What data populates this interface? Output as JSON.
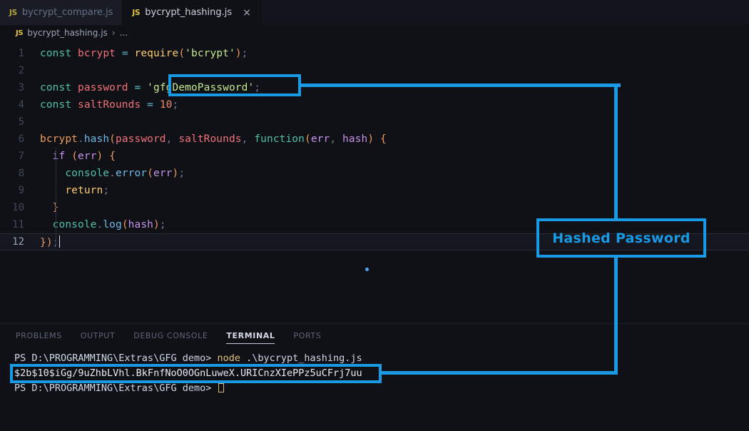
{
  "window": {
    "app": "Visual Studio Code",
    "theme_bg": "#0f1117",
    "accent": "#1a9ae4"
  },
  "tabs": [
    {
      "label": "bycrypt_compare.js",
      "icon": "js-file-icon",
      "badge": "JS",
      "active": false,
      "closable": false
    },
    {
      "label": "bycrypt_hashing.js",
      "icon": "js-file-icon",
      "badge": "JS",
      "active": true,
      "closable": true,
      "close_glyph": "×"
    }
  ],
  "breadcrumb": {
    "badge": "JS",
    "file": "bycrypt_hashing.js",
    "separator": "›",
    "more": "..."
  },
  "editor": {
    "language": "javascript",
    "active_line": 12,
    "lines": [
      {
        "n": "1",
        "tokens": [
          {
            "t": "const",
            "c": "t-kw"
          },
          {
            "t": " ",
            "c": ""
          },
          {
            "t": "bcrypt",
            "c": "t-var"
          },
          {
            "t": " ",
            "c": ""
          },
          {
            "t": "=",
            "c": "t-op"
          },
          {
            "t": " ",
            "c": ""
          },
          {
            "t": "require",
            "c": "t-fn"
          },
          {
            "t": "(",
            "c": "t-punc"
          },
          {
            "t": "'bcrypt'",
            "c": "t-str"
          },
          {
            "t": ")",
            "c": "t-punc"
          },
          {
            "t": ";",
            "c": "t-semi"
          }
        ]
      },
      {
        "n": "2",
        "tokens": []
      },
      {
        "n": "3",
        "tokens": [
          {
            "t": "const",
            "c": "t-kw"
          },
          {
            "t": " ",
            "c": ""
          },
          {
            "t": "password",
            "c": "t-var"
          },
          {
            "t": " ",
            "c": ""
          },
          {
            "t": "=",
            "c": "t-op"
          },
          {
            "t": " ",
            "c": ""
          },
          {
            "t": "'gfgDemoPassword'",
            "c": "t-str"
          },
          {
            "t": ";",
            "c": "t-semi"
          }
        ]
      },
      {
        "n": "4",
        "tokens": [
          {
            "t": "const",
            "c": "t-kw"
          },
          {
            "t": " ",
            "c": ""
          },
          {
            "t": "saltRounds",
            "c": "t-var"
          },
          {
            "t": " ",
            "c": ""
          },
          {
            "t": "=",
            "c": "t-op"
          },
          {
            "t": " ",
            "c": ""
          },
          {
            "t": "10",
            "c": "t-num"
          },
          {
            "t": ";",
            "c": "t-semi"
          }
        ]
      },
      {
        "n": "5",
        "tokens": []
      },
      {
        "n": "6",
        "tokens": [
          {
            "t": "bcrypt",
            "c": "t-obj"
          },
          {
            "t": ".",
            "c": "t-dot"
          },
          {
            "t": "hash",
            "c": "t-meth"
          },
          {
            "t": "(",
            "c": "t-punc"
          },
          {
            "t": "password",
            "c": "t-var"
          },
          {
            "t": ",",
            "c": "t-comma"
          },
          {
            "t": " ",
            "c": ""
          },
          {
            "t": "saltRounds",
            "c": "t-var"
          },
          {
            "t": ",",
            "c": "t-comma"
          },
          {
            "t": " ",
            "c": ""
          },
          {
            "t": "function",
            "c": "t-kw"
          },
          {
            "t": "(",
            "c": "t-punc"
          },
          {
            "t": "err",
            "c": "t-param"
          },
          {
            "t": ",",
            "c": "t-comma"
          },
          {
            "t": " ",
            "c": ""
          },
          {
            "t": "hash",
            "c": "t-param"
          },
          {
            "t": ")",
            "c": "t-punc"
          },
          {
            "t": " ",
            "c": ""
          },
          {
            "t": "{",
            "c": "t-punc"
          }
        ]
      },
      {
        "n": "7",
        "tokens": [
          {
            "t": "  ",
            "c": ""
          },
          {
            "t": "if",
            "c": "t-ctrl"
          },
          {
            "t": " ",
            "c": ""
          },
          {
            "t": "(",
            "c": "t-punc"
          },
          {
            "t": "err",
            "c": "t-param"
          },
          {
            "t": ")",
            "c": "t-punc"
          },
          {
            "t": " ",
            "c": ""
          },
          {
            "t": "{",
            "c": "t-punc"
          }
        ]
      },
      {
        "n": "8",
        "tokens": [
          {
            "t": "    ",
            "c": ""
          },
          {
            "t": "console",
            "c": "t-kw"
          },
          {
            "t": ".",
            "c": "t-dot"
          },
          {
            "t": "error",
            "c": "t-meth"
          },
          {
            "t": "(",
            "c": "t-punc"
          },
          {
            "t": "err",
            "c": "t-param"
          },
          {
            "t": ")",
            "c": "t-punc"
          },
          {
            "t": ";",
            "c": "t-semi"
          }
        ]
      },
      {
        "n": "9",
        "tokens": [
          {
            "t": "    ",
            "c": ""
          },
          {
            "t": "return",
            "c": "t-fn"
          },
          {
            "t": ";",
            "c": "t-semi"
          }
        ]
      },
      {
        "n": "10",
        "tokens": [
          {
            "t": "  ",
            "c": ""
          },
          {
            "t": "}",
            "c": "t-punc"
          }
        ]
      },
      {
        "n": "11",
        "tokens": [
          {
            "t": "  ",
            "c": ""
          },
          {
            "t": "console",
            "c": "t-kw"
          },
          {
            "t": ".",
            "c": "t-dot"
          },
          {
            "t": "log",
            "c": "t-meth"
          },
          {
            "t": "(",
            "c": "t-punc"
          },
          {
            "t": "hash",
            "c": "t-param"
          },
          {
            "t": ")",
            "c": "t-punc"
          },
          {
            "t": ";",
            "c": "t-semi"
          }
        ]
      },
      {
        "n": "12",
        "tokens": [
          {
            "t": "}",
            "c": "t-punc"
          },
          {
            "t": ")",
            "c": "t-punc"
          },
          {
            "t": ";",
            "c": "t-semi"
          }
        ]
      }
    ]
  },
  "panel": {
    "tabs": [
      {
        "label": "PROBLEMS",
        "active": false
      },
      {
        "label": "OUTPUT",
        "active": false
      },
      {
        "label": "DEBUG CONSOLE",
        "active": false
      },
      {
        "label": "TERMINAL",
        "active": true
      },
      {
        "label": "PORTS",
        "active": false
      }
    ],
    "terminal": {
      "prompt_1": "PS D:\\PROGRAMMING\\Extras\\GFG demo> ",
      "command": "node",
      "command_args": " .\\bycrypt_hashing.js",
      "output": "$2b$10$iGg/9uZhbLVhl.BkFnfNoO0OGnLuweX.URICnzXIePPz5uCFrj7uu",
      "prompt_2": "PS D:\\PROGRAMMING\\Extras\\GFG demo> "
    }
  },
  "annotations": {
    "color": "#1a9ae4",
    "label": "Hashed Password",
    "highlighted_source": "'gfgDemoPassword';",
    "highlighted_result": "$2b$10$iGg/9uZhbLVhl.BkFnfNoO0OGnLuweX.URICnzXIePPz5uCFrj7uu"
  }
}
